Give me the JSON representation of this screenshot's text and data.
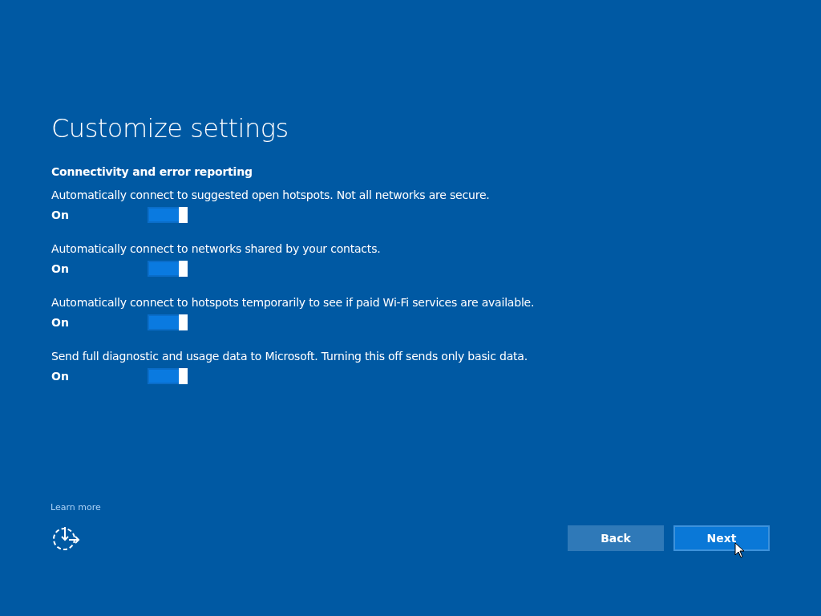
{
  "title": "Customize settings",
  "section": {
    "heading": "Connectivity and error reporting",
    "settings": [
      {
        "description": "Automatically connect to suggested open hotspots. Not all networks are secure.",
        "state_label": "On",
        "on": true
      },
      {
        "description": "Automatically connect to networks shared by your contacts.",
        "state_label": "On",
        "on": true
      },
      {
        "description": "Automatically connect to hotspots temporarily to see if paid Wi-Fi services are available.",
        "state_label": "On",
        "on": true
      },
      {
        "description": "Send full diagnostic and usage data to Microsoft. Turning this off sends only basic data.",
        "state_label": "On",
        "on": true
      }
    ]
  },
  "learn_more": "Learn more",
  "buttons": [
    {
      "label": "Back",
      "kind": "secondary"
    },
    {
      "label": "Next",
      "kind": "primary"
    }
  ]
}
